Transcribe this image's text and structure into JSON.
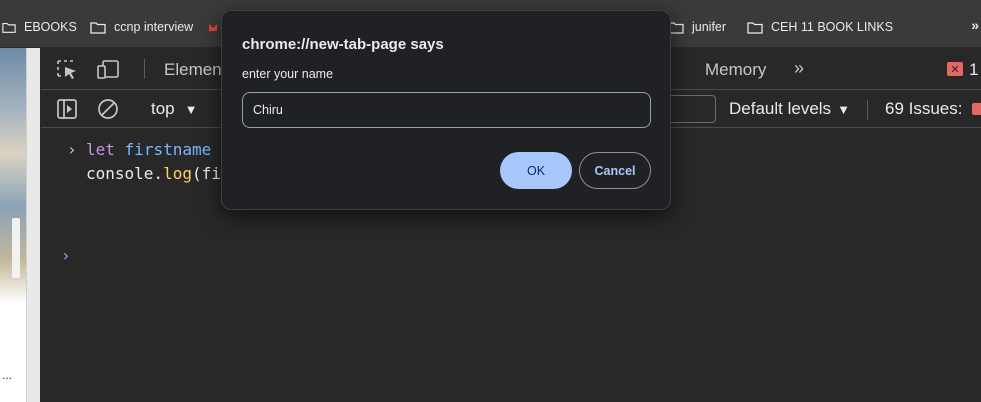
{
  "bookmarks": {
    "items": [
      {
        "label": "EBOOKS"
      },
      {
        "label": "ccnp interview"
      },
      {
        "label": "junifer"
      },
      {
        "label": "CEH 11 BOOK LINKS"
      }
    ],
    "more": "»"
  },
  "page": {
    "ellipsis": "..."
  },
  "devtools": {
    "tabs": {
      "elements": "Elemen",
      "memory": "Memory",
      "more": "»"
    },
    "error_count": "1",
    "toolbar": {
      "context": "top",
      "levels": "Default levels",
      "issues": "69 Issues:"
    },
    "console": {
      "line1": {
        "keyword": "let",
        "name": "firstname"
      },
      "line2": {
        "object": "console.",
        "method": "log",
        "rest": "(fi"
      }
    }
  },
  "dialog": {
    "title": "chrome://new-tab-page says",
    "message": "enter your name",
    "input_value": "Chiru",
    "ok_label": "OK",
    "cancel_label": "Cancel"
  },
  "colors": {
    "accent": "#a8c7fa",
    "error": "#e46962",
    "keyword": "#c792ea",
    "variable": "#7ab7ff",
    "method": "#ffd166"
  }
}
